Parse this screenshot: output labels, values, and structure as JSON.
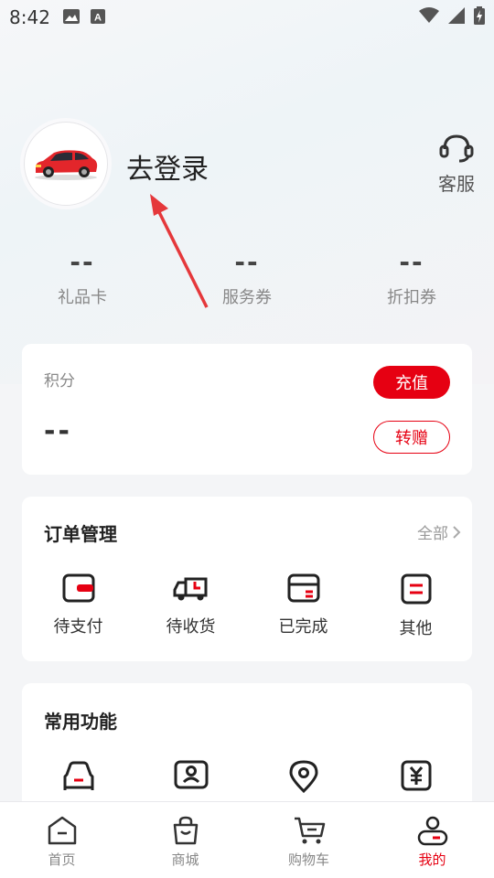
{
  "status_bar": {
    "time": "8:42"
  },
  "profile": {
    "login_text": "去登录",
    "service_label": "客服"
  },
  "stats": [
    {
      "value": "--",
      "label": "礼品卡"
    },
    {
      "value": "--",
      "label": "服务券"
    },
    {
      "value": "--",
      "label": "折扣券"
    }
  ],
  "points": {
    "label": "积分",
    "value": "--",
    "recharge_label": "充值",
    "transfer_label": "转赠"
  },
  "orders": {
    "title": "订单管理",
    "all_label": "全部",
    "items": [
      {
        "label": "待支付",
        "icon": "wallet-icon"
      },
      {
        "label": "待收货",
        "icon": "truck-icon"
      },
      {
        "label": "已完成",
        "icon": "box-icon"
      },
      {
        "label": "其他",
        "icon": "list-icon"
      }
    ]
  },
  "common": {
    "title": "常用功能",
    "items": [
      {
        "icon": "car-icon"
      },
      {
        "icon": "id-card-icon"
      },
      {
        "icon": "location-icon"
      },
      {
        "icon": "yuan-icon"
      }
    ]
  },
  "tabbar": {
    "items": [
      {
        "label": "首页",
        "icon": "home-icon",
        "active": false
      },
      {
        "label": "商城",
        "icon": "shopping-bag-icon",
        "active": false
      },
      {
        "label": "购物车",
        "icon": "cart-icon",
        "active": false
      },
      {
        "label": "我的",
        "icon": "user-icon",
        "active": true
      }
    ]
  },
  "colors": {
    "accent": "#e60012",
    "text": "#222222",
    "muted": "#888888"
  }
}
